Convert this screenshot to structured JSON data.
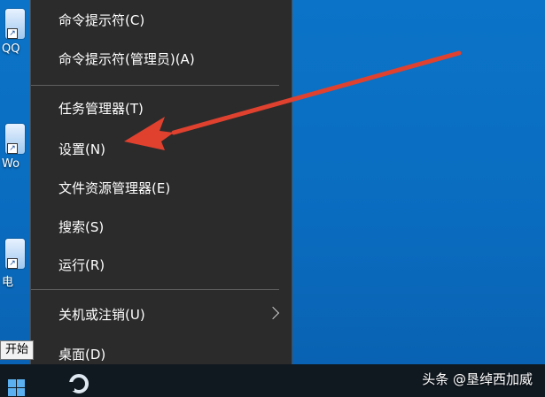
{
  "desktop": {
    "icons": [
      {
        "label": "QQ",
        "icon": "app-shortcut-icon"
      },
      {
        "label": "Wo",
        "icon": "app-shortcut-icon"
      },
      {
        "label": "电",
        "icon": "app-shortcut-icon"
      }
    ]
  },
  "menu": {
    "items": [
      {
        "label": "命令提示符(C)"
      },
      {
        "label": "命令提示符(管理员)(A)"
      },
      {
        "label": "任务管理器(T)"
      },
      {
        "label": "设置(N)"
      },
      {
        "label": "文件资源管理器(E)"
      },
      {
        "label": "搜索(S)"
      },
      {
        "label": "运行(R)"
      },
      {
        "label": "关机或注销(U)",
        "has_submenu": true
      },
      {
        "label": "桌面(D)"
      }
    ]
  },
  "tooltip": {
    "text": "开始"
  },
  "watermark": {
    "text": "头条 @垦绰西加威"
  },
  "colors": {
    "menu_bg": "#2b2b2b",
    "desktop": "#0a6cbf",
    "arrow": "#e0412f",
    "taskbar": "#101820"
  }
}
